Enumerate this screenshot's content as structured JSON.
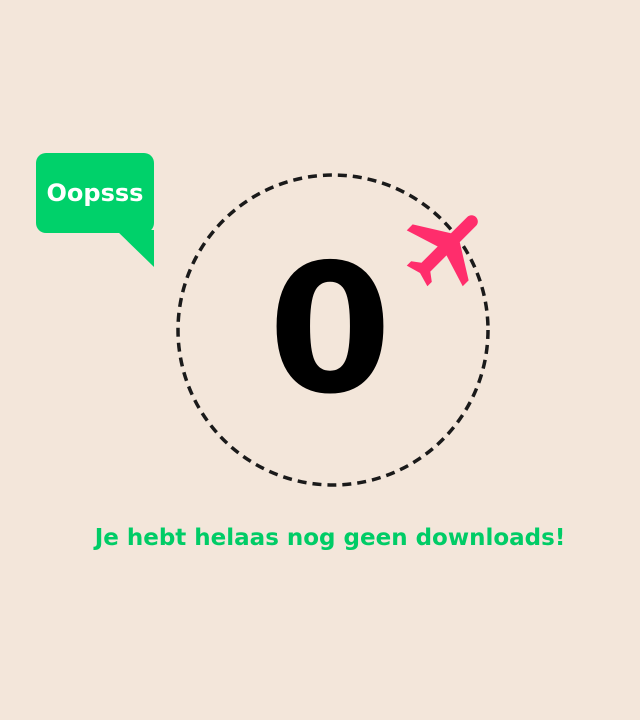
{
  "bubble": {
    "label": "Oopsss"
  },
  "counter": {
    "value": "0"
  },
  "message": {
    "text": "Je hebt helaas nog geen downloads!"
  },
  "icons": {
    "plane": "airplane-icon"
  },
  "colors": {
    "background": "#f3e6da",
    "accent_green": "#00d16a",
    "plane_pink": "#ff2d6c",
    "text_dark": "#000000"
  }
}
